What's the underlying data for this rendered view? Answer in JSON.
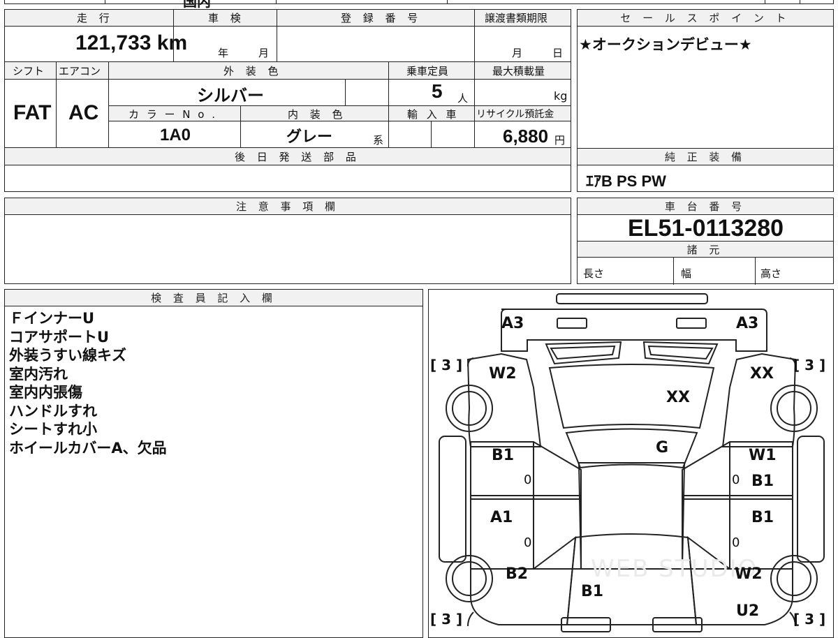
{
  "top_fragment": "国内",
  "vehicle": {
    "labels": {
      "mileage": "走 行",
      "inspection": "車 検",
      "registration": "登 録 番 号",
      "transfer_deadline": "譲渡書類期限",
      "shift": "シフト",
      "aircon": "エアコン",
      "exterior_color": "外 装 色",
      "capacity": "乗車定員",
      "max_load": "最大積載量",
      "color_no": "カ ラ ー N o .",
      "interior_color": "内 装 色",
      "import": "輸 入 車",
      "recycle": "リサイクル預託金",
      "later_parts": "後 日 発 送 部 品",
      "year_unit": "年",
      "month_unit": "月",
      "day_unit": "日",
      "person_unit": "人",
      "kg_unit": "kg",
      "yen_unit": "円",
      "kei_unit": "系"
    },
    "mileage": "121,733 km",
    "shift": "FAT",
    "aircon": "AC",
    "exterior_color": "シルバー",
    "capacity": "5",
    "color_no": "1A0",
    "interior_color": "グレー",
    "recycle_fee": "6,880"
  },
  "sales_point": {
    "label": "セ ー ル ス ポ イ ン ト",
    "text": "★オークションデビュー★"
  },
  "genuine_equipment": {
    "label": "純 正 装 備",
    "text": "ｴｱB PS PW"
  },
  "caution": {
    "label": "注 意 事 項 欄"
  },
  "chassis": {
    "label": "車 台 番 号",
    "number": "EL51-0113280",
    "specs_label": "諸 元",
    "length_label": "長さ",
    "width_label": "幅",
    "height_label": "高さ"
  },
  "inspector": {
    "label": "検 査 員 記 入 欄",
    "notes": [
      "ＦインナーU",
      "コアサポートU",
      "外装うすい線キズ",
      "室内汚れ",
      "室内内張傷",
      "ハンドルすれ",
      "シートすれ小",
      "ホイールカバーA、欠品"
    ]
  },
  "diagram": {
    "watermark": "WEB STUDIO",
    "codes": {
      "front_left": "A3",
      "front_right": "A3",
      "fender_left": "W2",
      "fender_right": "XX",
      "hood": "XX",
      "windshield": "G",
      "front_door_left": "B1",
      "front_door_right_top": "W1",
      "front_door_right": "B1",
      "rear_door_left": "A1",
      "rear_door_right": "B1",
      "quarter_left": "B2",
      "quarter_right": "W2",
      "rear_gate": "B1",
      "rear_right": "U2"
    },
    "tires": {
      "front_left": "[ 3 ]",
      "front_right": "[ 3 ]",
      "rear_left": "[ 3 ]",
      "rear_right": "[ 3 ]"
    },
    "zero": "0"
  }
}
